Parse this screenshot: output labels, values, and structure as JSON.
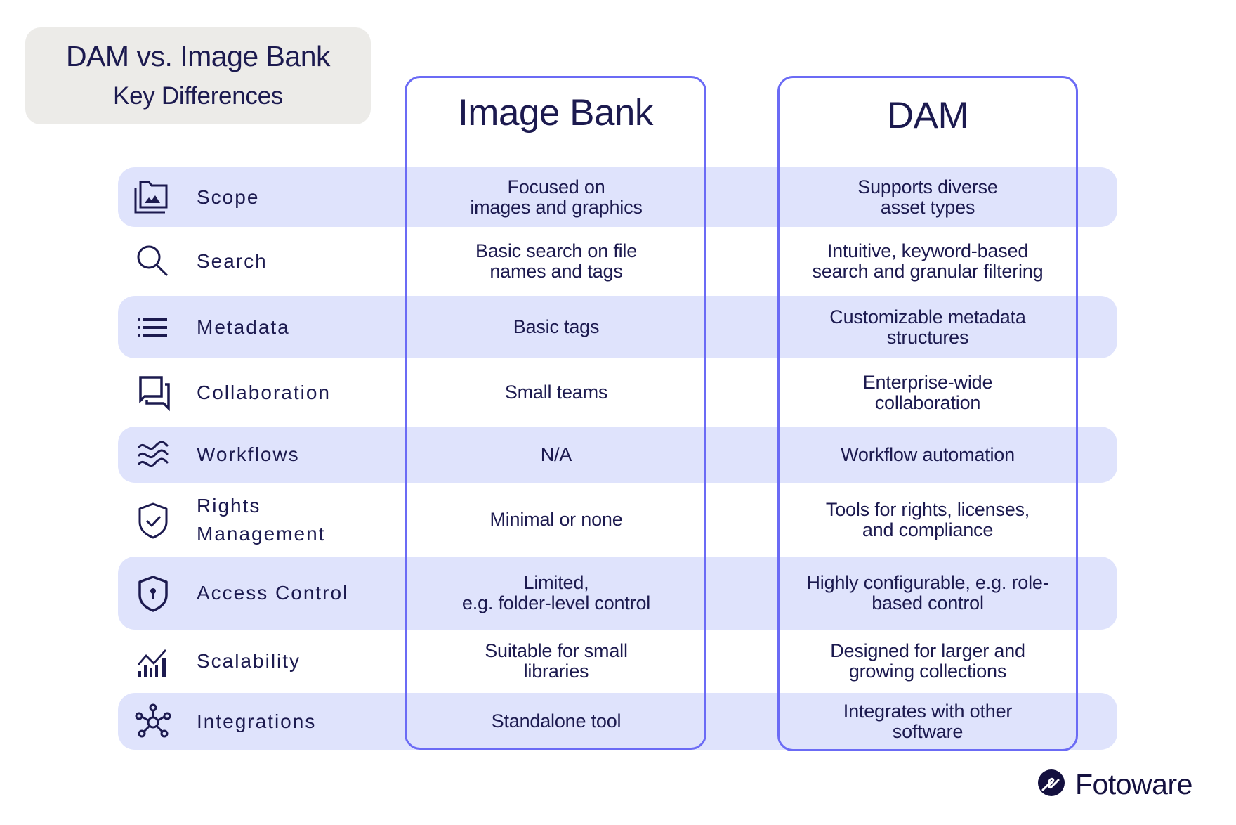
{
  "title": {
    "main": "DAM vs. Image Bank",
    "sub": "Key Differences"
  },
  "columns": {
    "image_bank": "Image Bank",
    "dam": "DAM"
  },
  "colors": {
    "text": "#1c1a4f",
    "accent_border": "#6b6bf5",
    "row_shade": "#dfe3fc",
    "title_bg": "#ecebe8"
  },
  "rows": [
    {
      "icon": "image-folder-icon",
      "label": "Scope",
      "image_bank": "Focused on\nimages and graphics",
      "dam": "Supports diverse\nasset types"
    },
    {
      "icon": "search-icon",
      "label": "Search",
      "image_bank": "Basic search on file\nnames and tags",
      "dam": "Intuitive, keyword-based\nsearch and granular filtering"
    },
    {
      "icon": "list-icon",
      "label": "Metadata",
      "image_bank": "Basic tags",
      "dam": "Customizable metadata\nstructures"
    },
    {
      "icon": "chat-bubbles-icon",
      "label": "Collaboration",
      "image_bank": "Small teams",
      "dam": "Enterprise-wide\ncollaboration"
    },
    {
      "icon": "waves-icon",
      "label": "Workflows",
      "image_bank": "N/A",
      "dam": "Workflow automation"
    },
    {
      "icon": "shield-check-icon",
      "label": "Rights\nManagement",
      "image_bank": "Minimal or none",
      "dam": "Tools for rights, licenses,\nand compliance"
    },
    {
      "icon": "shield-keyhole-icon",
      "label": "Access Control",
      "image_bank": "Limited,\ne.g. folder-level control",
      "dam": "Highly configurable, e.g. role-\nbased control"
    },
    {
      "icon": "growth-chart-icon",
      "label": "Scalability",
      "image_bank": "Suitable for small\nlibraries",
      "dam": "Designed for larger and\ngrowing collections"
    },
    {
      "icon": "network-hub-icon",
      "label": "Integrations",
      "image_bank": "Standalone tool",
      "dam": "Integrates with other\nsoftware"
    }
  ],
  "brand": {
    "name": "Fotoware",
    "icon": "fotoware-logo-icon"
  }
}
